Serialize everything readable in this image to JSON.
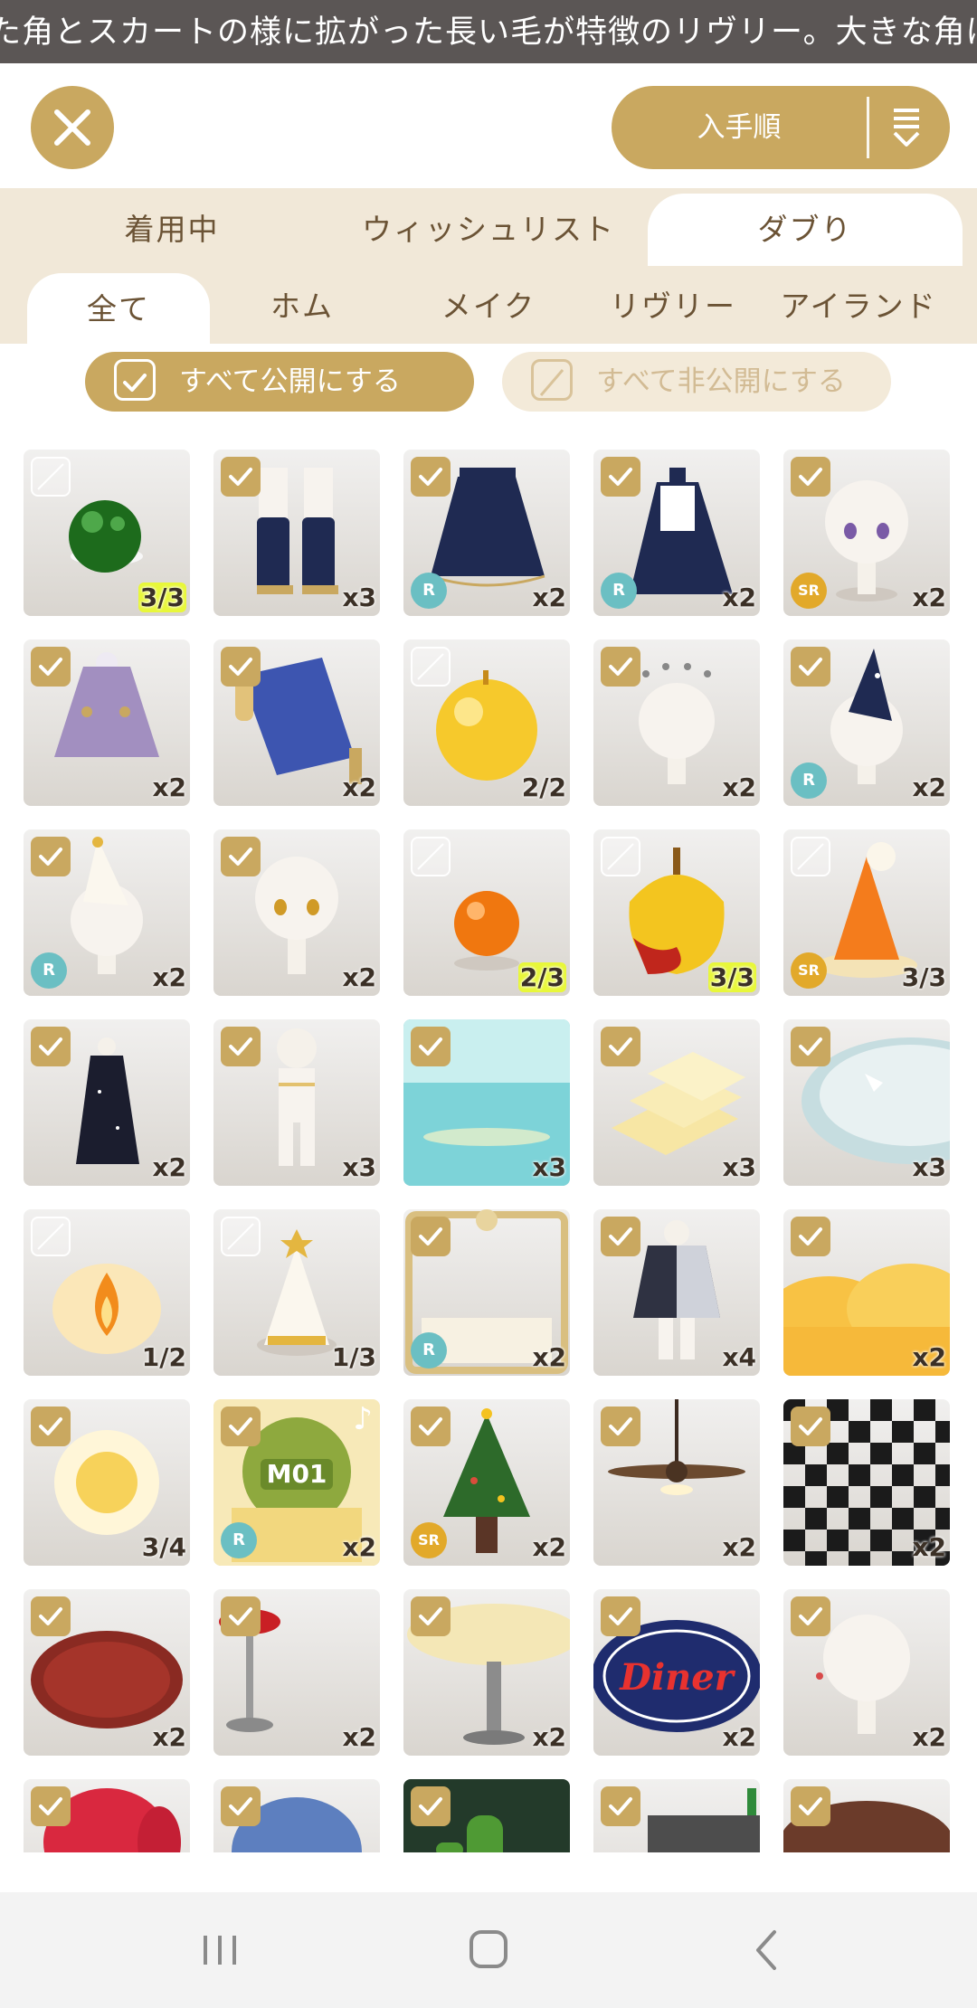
{
  "banner": {
    "text": "た角とスカートの様に拡がった長い毛が特徴のリヴリー。大きな角は頭"
  },
  "header": {
    "sort_label": "入手順"
  },
  "tabs": [
    {
      "label": "着用中",
      "active": false
    },
    {
      "label": "ウィッシュリスト",
      "active": false
    },
    {
      "label": "ダブり",
      "active": true
    }
  ],
  "subtabs": [
    {
      "label": "全て",
      "active": true
    },
    {
      "label": "ホム",
      "active": false
    },
    {
      "label": "メイク",
      "active": false
    },
    {
      "label": "リヴリー",
      "active": false
    },
    {
      "label": "アイランド",
      "active": false
    }
  ],
  "toggles": {
    "public_all": "すべて公開にする",
    "private_all": "すべて非公開にする"
  },
  "colors": {
    "accent": "#c9a860",
    "tab_bg": "#f1e8d8",
    "rarity_R": "#6bbfc3",
    "rarity_SR": "#e2a92a"
  },
  "items": [
    {
      "name": "green-fluff-ball",
      "checked": false,
      "count": "3/3",
      "highlight": true,
      "rarity": ""
    },
    {
      "name": "navy-boots",
      "checked": true,
      "count": "x3",
      "highlight": false,
      "rarity": ""
    },
    {
      "name": "navy-skirt",
      "checked": true,
      "count": "x2",
      "highlight": false,
      "rarity": "R"
    },
    {
      "name": "navy-cape",
      "checked": true,
      "count": "x2",
      "highlight": false,
      "rarity": "R"
    },
    {
      "name": "purple-eyes-head",
      "checked": true,
      "count": "x2",
      "highlight": false,
      "rarity": "SR"
    },
    {
      "name": "lavender-poncho",
      "checked": true,
      "count": "x2",
      "highlight": false,
      "rarity": ""
    },
    {
      "name": "blue-sleeve",
      "checked": true,
      "count": "x2",
      "highlight": false,
      "rarity": ""
    },
    {
      "name": "golden-apple",
      "checked": false,
      "count": "2/2",
      "highlight": false,
      "rarity": ""
    },
    {
      "name": "dot-halo-head",
      "checked": true,
      "count": "x2",
      "highlight": false,
      "rarity": ""
    },
    {
      "name": "navy-star-hat",
      "checked": true,
      "count": "x2",
      "highlight": false,
      "rarity": "R"
    },
    {
      "name": "white-star-hat",
      "checked": true,
      "count": "x2",
      "highlight": false,
      "rarity": "R"
    },
    {
      "name": "amber-eyes-head",
      "checked": true,
      "count": "x2",
      "highlight": false,
      "rarity": ""
    },
    {
      "name": "orange-jelly",
      "checked": false,
      "count": "2/3",
      "highlight": true,
      "rarity": ""
    },
    {
      "name": "candy-apple",
      "checked": false,
      "count": "3/3",
      "highlight": true,
      "rarity": ""
    },
    {
      "name": "party-hat-orange",
      "checked": false,
      "count": "3/3",
      "highlight": false,
      "rarity": "SR"
    },
    {
      "name": "starry-dress",
      "checked": true,
      "count": "x2",
      "highlight": false,
      "rarity": ""
    },
    {
      "name": "white-suit",
      "checked": true,
      "count": "x3",
      "highlight": false,
      "rarity": ""
    },
    {
      "name": "sea-background",
      "checked": true,
      "count": "x3",
      "highlight": false,
      "rarity": ""
    },
    {
      "name": "butter-stairs",
      "checked": true,
      "count": "x3",
      "highlight": false,
      "rarity": ""
    },
    {
      "name": "star-platform",
      "checked": true,
      "count": "x3",
      "highlight": false,
      "rarity": ""
    },
    {
      "name": "flame",
      "checked": false,
      "count": "1/2",
      "highlight": false,
      "rarity": ""
    },
    {
      "name": "white-star-cone",
      "checked": false,
      "count": "1/3",
      "highlight": false,
      "rarity": ""
    },
    {
      "name": "gold-frame",
      "checked": true,
      "count": "x2",
      "highlight": false,
      "rarity": "R"
    },
    {
      "name": "night-cloak",
      "checked": true,
      "count": "x4",
      "highlight": false,
      "rarity": ""
    },
    {
      "name": "golden-cloud",
      "checked": true,
      "count": "x2",
      "highlight": false,
      "rarity": ""
    },
    {
      "name": "sun",
      "checked": true,
      "count": "3/4",
      "highlight": false,
      "rarity": ""
    },
    {
      "name": "m01-music-card",
      "checked": true,
      "count": "x2",
      "highlight": false,
      "rarity": "R",
      "card_text": "M01"
    },
    {
      "name": "christmas-tree",
      "checked": true,
      "count": "x2",
      "highlight": false,
      "rarity": "SR"
    },
    {
      "name": "ceiling-fan",
      "checked": true,
      "count": "x2",
      "highlight": false,
      "rarity": ""
    },
    {
      "name": "checker-floor",
      "checked": true,
      "count": "x2",
      "highlight": false,
      "rarity": ""
    },
    {
      "name": "red-rug",
      "checked": true,
      "count": "x2",
      "highlight": false,
      "rarity": ""
    },
    {
      "name": "bar-stool",
      "checked": true,
      "count": "x2",
      "highlight": false,
      "rarity": ""
    },
    {
      "name": "diner-table",
      "checked": true,
      "count": "x2",
      "highlight": false,
      "rarity": ""
    },
    {
      "name": "diner-sign",
      "checked": true,
      "count": "x2",
      "highlight": false,
      "rarity": "",
      "sign_text": "Diner"
    },
    {
      "name": "earring-head",
      "checked": true,
      "count": "x2",
      "highlight": false,
      "rarity": ""
    },
    {
      "name": "red-hair",
      "checked": true,
      "count": "",
      "highlight": false,
      "rarity": ""
    },
    {
      "name": "blue-hair",
      "checked": true,
      "count": "",
      "highlight": false,
      "rarity": ""
    },
    {
      "name": "cactus-music-card",
      "checked": true,
      "count": "",
      "highlight": false,
      "rarity": ""
    },
    {
      "name": "diner-counter",
      "checked": true,
      "count": "",
      "highlight": false,
      "rarity": ""
    },
    {
      "name": "brown-table",
      "checked": true,
      "count": "",
      "highlight": false,
      "rarity": ""
    }
  ]
}
